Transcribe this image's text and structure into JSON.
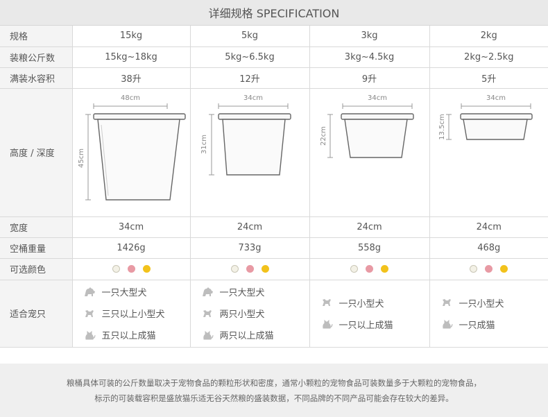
{
  "header": {
    "title": "详细规格 SPECIFICATION"
  },
  "rows": {
    "spec": {
      "label": "规格",
      "values": [
        "15kg",
        "5kg",
        "3kg",
        "2kg"
      ]
    },
    "load": {
      "label": "装粮公斤数",
      "values": [
        "15kg~18kg",
        "5kg~6.5kg",
        "3kg~4.5kg",
        "2kg~2.5kg"
      ]
    },
    "volume": {
      "label": "满装水容积",
      "values": [
        "38升",
        "12升",
        "9升",
        "5升"
      ]
    },
    "dims": {
      "label": "高度 / 深度",
      "top_widths": [
        "48cm",
        "34cm",
        "34cm",
        "34cm"
      ],
      "heights": [
        "45cm",
        "31cm",
        "22cm",
        "13.5cm"
      ]
    },
    "width": {
      "label": "宽度",
      "values": [
        "34cm",
        "24cm",
        "24cm",
        "24cm"
      ]
    },
    "weight": {
      "label": "空桶重量",
      "values": [
        "1426g",
        "733g",
        "558g",
        "468g"
      ]
    },
    "colors": {
      "label": "可选颜色",
      "swatches": [
        "#f3f1e6",
        "#e89aa4",
        "#f2c21c"
      ]
    },
    "pets": {
      "label": "适合宠只",
      "columns": [
        [
          {
            "icon": "large-dog-icon",
            "text": "一只大型犬"
          },
          {
            "icon": "small-dog-icon",
            "text": "三只以上小型犬"
          },
          {
            "icon": "cat-icon",
            "text": "五只以上成猫"
          }
        ],
        [
          {
            "icon": "large-dog-icon",
            "text": "一只大型犬"
          },
          {
            "icon": "small-dog-icon",
            "text": "两只小型犬"
          },
          {
            "icon": "cat-icon",
            "text": "两只以上成猫"
          }
        ],
        [
          {
            "icon": "small-dog-icon",
            "text": "一只小型犬"
          },
          {
            "icon": "cat-icon",
            "text": "一只以上成猫"
          }
        ],
        [
          {
            "icon": "small-dog-icon",
            "text": "一只小型犬"
          },
          {
            "icon": "cat-icon",
            "text": "一只成猫"
          }
        ]
      ]
    }
  },
  "note": {
    "line1": "粮桶具体可装的公斤数量取决于宠物食品的颗粒形状和密度，通常小颗粒的宠物食品可装数量多于大颗粒的宠物食品，",
    "line2": "标示的可装载容积是盛放猫乐适无谷天然粮的盛装数据，不同品牌的不同产品可能会存在较大的差异。"
  }
}
